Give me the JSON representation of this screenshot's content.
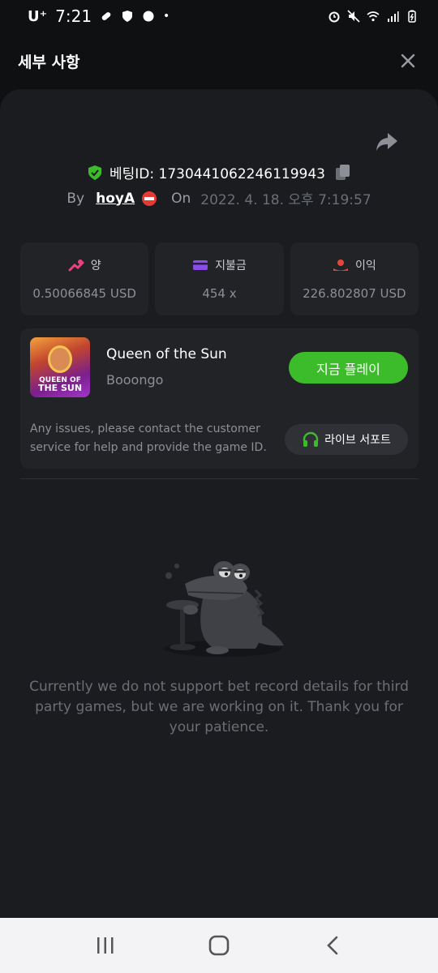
{
  "status_bar": {
    "carrier": "U⁺",
    "time": "7:21",
    "dot": "•"
  },
  "header": {
    "title": "세부 사항",
    "close_icon": "close-icon"
  },
  "bet": {
    "label": "베팅ID:",
    "id": "1730441062246119943",
    "by_label": "By",
    "username": "hoyA",
    "on_label": "On",
    "date": "2022. 4. 18. 오후 7:19:57"
  },
  "stats": [
    {
      "label": "양",
      "value": "0.50066845 USD",
      "icon": "bet-amount-icon",
      "color": "#e8437c"
    },
    {
      "label": "지불금",
      "value": "454 x",
      "icon": "payout-card-icon",
      "color": "#8b4de8"
    },
    {
      "label": "이익",
      "value": "226.802807 USD",
      "icon": "profit-icon",
      "color": "#e64539"
    }
  ],
  "game": {
    "title": "Queen of the Sun",
    "provider": "Booongo",
    "thumb_text_1": "QUEEN OF",
    "thumb_text_2": "THE SUN",
    "play_label": "지금 플레이",
    "issues_text": "Any issues, please contact the customer service for help and provide the game ID.",
    "support_label": "라이브 서포트"
  },
  "empty_message": "Currently we do not support bet record details for third party games, but we are working on it. Thank you for your patience.",
  "colors": {
    "accent_green": "#3cbc2a",
    "panel": "#1b1c1f",
    "card": "#222327"
  }
}
